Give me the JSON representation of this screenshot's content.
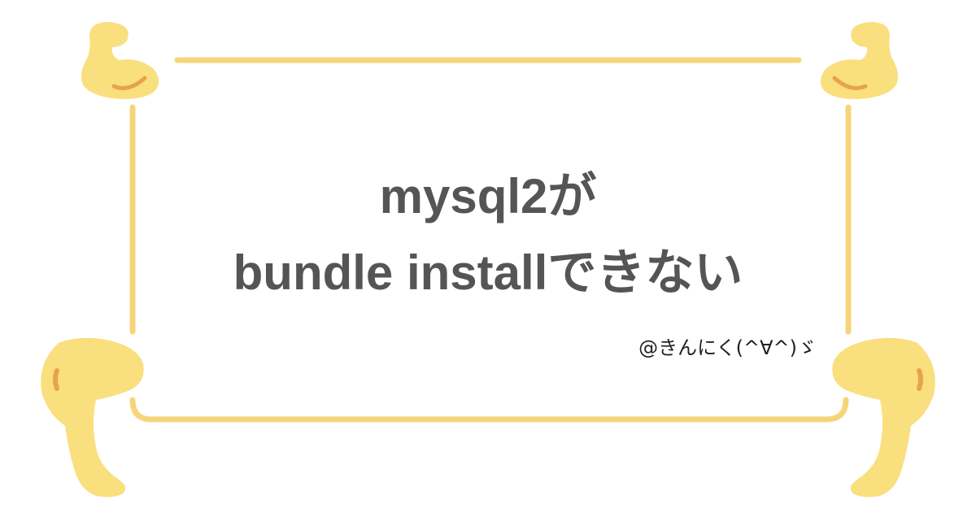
{
  "title": {
    "line1": "mysql2が",
    "line2": "bundle installできない"
  },
  "author": "@きんにく(^∀^)ゞ",
  "colors": {
    "background": "#ffffff",
    "frame_line": "#f6d57a",
    "mascot_fill": "#f9df7e",
    "mascot_accent": "#e8a24e",
    "title_text": "#555555",
    "author_text": "#222222"
  },
  "icons": {
    "top_left": "flexed-arm-icon",
    "top_right": "flexed-arm-icon",
    "bottom_left": "bent-leg-icon",
    "bottom_right": "bent-leg-icon"
  }
}
